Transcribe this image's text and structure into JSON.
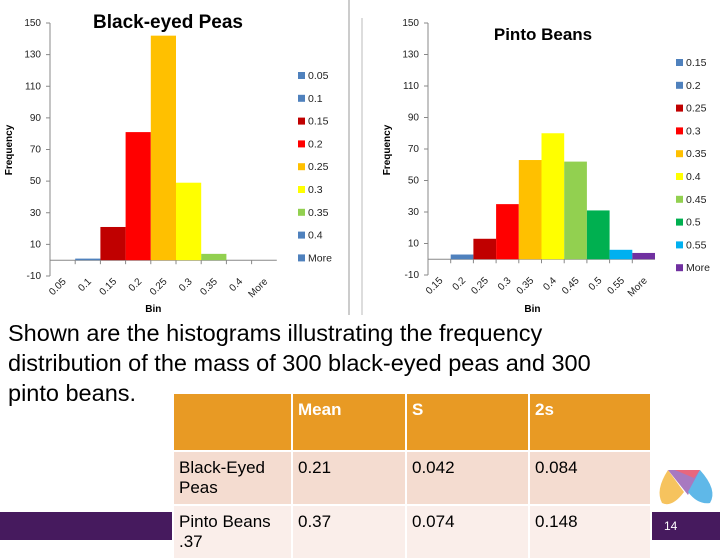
{
  "chart_data": [
    {
      "type": "bar",
      "title": "Black-eyed Peas",
      "xlabel": "Bin",
      "ylabel": "Frequency",
      "ylim": [
        -10,
        150
      ],
      "yticks": [
        150,
        130,
        110,
        90,
        70,
        50,
        30,
        10,
        -10
      ],
      "categories": [
        "0.05",
        "0.1",
        "0.15",
        "0.2",
        "0.25",
        "0.3",
        "0.35",
        "0.4",
        "More"
      ],
      "values": [
        0,
        1,
        21,
        81,
        142,
        49,
        4,
        0,
        0
      ],
      "colors": [
        "#4f81bd",
        "#4f81bd",
        "#c00000",
        "#ff0000",
        "#ffc000",
        "#ffff00",
        "#92d050",
        "#4f81bd",
        "#4f81bd"
      ],
      "legend": "right"
    },
    {
      "type": "bar",
      "title": "Pinto Beans",
      "xlabel": "Bin",
      "ylabel": "Frequency",
      "ylim": [
        -10,
        150
      ],
      "yticks": [
        150,
        130,
        110,
        90,
        70,
        50,
        30,
        10,
        -10
      ],
      "categories": [
        "0.15",
        "0.2",
        "0.25",
        "0.3",
        "0.35",
        "0.4",
        "0.45",
        "0.5",
        "0.55",
        "More"
      ],
      "values": [
        0,
        3,
        13,
        35,
        63,
        80,
        62,
        31,
        6,
        4
      ],
      "colors": [
        "#4f81bd",
        "#4f81bd",
        "#c00000",
        "#ff0000",
        "#ffc000",
        "#ffff00",
        "#92d050",
        "#00b050",
        "#00b0f0",
        "#7030a0"
      ],
      "legend": "right"
    }
  ],
  "caption": "Shown are the histograms illustrating the frequency distribution of the mass of 300 black-eyed peas and 300 pinto beans.",
  "table": {
    "headers": [
      "",
      "Mean",
      "S",
      "2s"
    ],
    "rows": [
      [
        "Black-Eyed Peas",
        "0.21",
        "0.042",
        "0.084"
      ],
      [
        "Pinto Beans .37",
        "0.37",
        "0.074",
        "0.148"
      ]
    ]
  },
  "page_number": "14",
  "colors": {
    "footer": "#461a5e",
    "table_header": "#e89a24"
  }
}
